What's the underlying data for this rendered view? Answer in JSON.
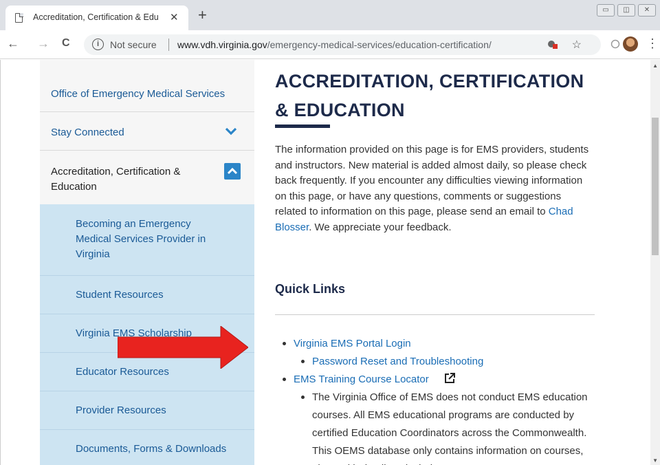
{
  "browser": {
    "tab_title": "Accreditation, Certification & Edu",
    "tab_close": "✕",
    "new_tab": "+",
    "win_minimize": "▭",
    "win_restore": "◫",
    "win_close": "✕",
    "back": "←",
    "forward": "→",
    "reload": "C",
    "info": "i",
    "security_label": "Not secure",
    "url_host": "www.vdh.virginia.gov",
    "url_path": "/emergency-medical-services/education-certification/",
    "star": "☆",
    "kebab": "⋮"
  },
  "sidebar": {
    "office_label": "Office of Emergency Medical Services",
    "stay_connected_label": "Stay Connected",
    "accreditation_label": "Accreditation, Certification & Education",
    "sub_items": [
      "Becoming an Emergency Medical Services Provider in Virginia",
      "Student Resources",
      "Virginia EMS Scholarship",
      "Educator Resources",
      "Provider Resources",
      "Documents, Forms & Downloads"
    ]
  },
  "main": {
    "title": "ACCREDITATION, CERTIFICATION & EDUCATION",
    "intro_before": "The information provided on this page is for EMS providers, students and instructors. New material is added almost daily, so please check back frequently. If you encounter any difficulties viewing information on this page, or have any questions, comments or suggestions related to information on this page, please send an email to ",
    "intro_link": "Chad Blosser",
    "intro_after": ". We appreciate your feedback.",
    "quick_links_heading": "Quick Links",
    "links": {
      "portal_login": "Virginia EMS Portal Login",
      "password_reset": "Password Reset and Troubleshooting",
      "course_locator": "EMS Training Course Locator",
      "external_icon": "↗",
      "locator_note": "The Virginia Office of EMS does not conduct EMS education courses.  All EMS educational programs are conducted by certified Education Coordinators across the Commonwealth.  This OEMS database only contains information on courses, along with details to include"
    }
  },
  "colors": {
    "link": "#1a6db5",
    "sidebar_link": "#1a5a96",
    "title": "#1d2a4a",
    "sub_bg": "#cde4f2",
    "chevron_box": "#2b85c8",
    "arrow": "#e8231f"
  }
}
